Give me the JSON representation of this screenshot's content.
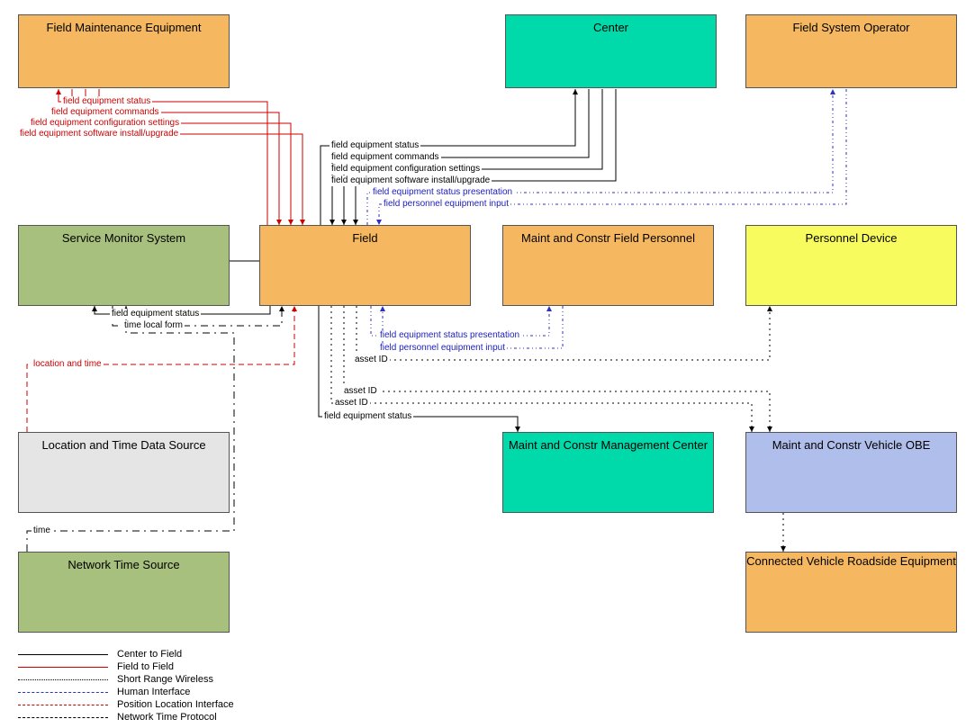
{
  "nodes": {
    "fme": {
      "label": "Field Maintenance Equipment"
    },
    "center": {
      "label": "Center"
    },
    "fso": {
      "label": "Field System Operator"
    },
    "sms": {
      "label": "Service Monitor System"
    },
    "field": {
      "label": "Field"
    },
    "mcfp": {
      "label": "Maint and Constr Field Personnel"
    },
    "pd": {
      "label": "Personnel Device"
    },
    "ltds": {
      "label": "Location and Time Data Source"
    },
    "mcm": {
      "label": "Maint and Constr Management Center"
    },
    "mcvobe": {
      "label": "Maint and Constr Vehicle OBE"
    },
    "nts": {
      "label": "Network Time Source"
    },
    "cvre": {
      "label": "Connected Vehicle Roadside Equipment"
    }
  },
  "flows": {
    "fes": "field equipment status",
    "fec": "field equipment commands",
    "fecs": "field equipment configuration settings",
    "fesiu": "field equipment software install/upgrade",
    "fesp": "field equipment status presentation",
    "fpei": "field personnel equipment input",
    "asset": "asset ID",
    "tlf": "time local form",
    "lat": "location and time",
    "time": "time"
  },
  "legend": {
    "l1": "Center to Field",
    "l2": "Field to Field",
    "l3": "Short Range Wireless",
    "l4": "Human Interface",
    "l5": "Position Location Interface",
    "l6": "Network Time Protocol"
  }
}
